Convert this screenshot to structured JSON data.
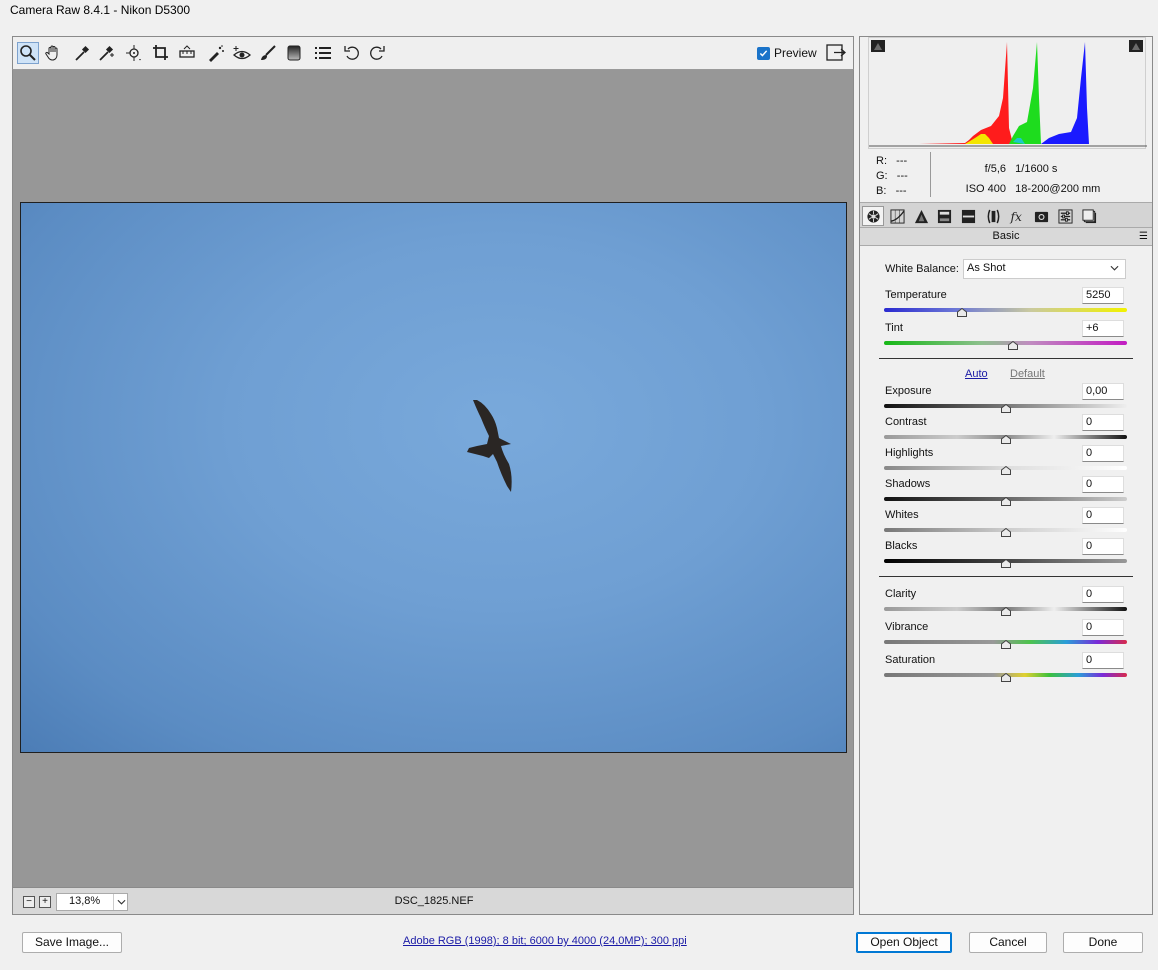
{
  "window": {
    "title": "Camera Raw 8.4.1  -  Nikon D5300"
  },
  "toolbar": {
    "tools": [
      {
        "name": "zoom-tool-icon",
        "active": true
      },
      {
        "name": "hand-tool-icon"
      },
      {
        "name": "white-balance-tool-icon"
      },
      {
        "name": "color-sampler-tool-icon"
      },
      {
        "name": "targeted-adjustment-tool-icon"
      },
      {
        "name": "crop-tool-icon"
      },
      {
        "name": "straighten-tool-icon"
      },
      {
        "name": "spot-removal-tool-icon"
      },
      {
        "name": "red-eye-removal-tool-icon"
      },
      {
        "name": "adjustment-brush-icon"
      },
      {
        "name": "graduated-filter-icon"
      },
      {
        "name": "preferences-list-icon"
      },
      {
        "name": "rotate-ccw-icon"
      },
      {
        "name": "rotate-cw-icon"
      }
    ],
    "preview_label": "Preview",
    "preview_checked": true
  },
  "status": {
    "zoom": "13,8%",
    "filename": "DSC_1825.NEF"
  },
  "info": {
    "r_label": "R:",
    "r_value": "---",
    "g_label": "G:",
    "g_value": "---",
    "b_label": "B:",
    "b_value": "---",
    "aperture": "f/5,6",
    "shutter": "1/1600 s",
    "iso": "ISO 400",
    "lens": "18-200@200 mm"
  },
  "panel": {
    "title": "Basic",
    "white_balance_label": "White Balance:",
    "white_balance_value": "As Shot",
    "auto_label": "Auto",
    "default_label": "Default",
    "sliders": [
      {
        "key": "temperature",
        "label": "Temperature",
        "value": "5250",
        "pos": 0.32
      },
      {
        "key": "tint",
        "label": "Tint",
        "value": "+6",
        "pos": 0.53
      },
      {
        "key": "exposure",
        "label": "Exposure",
        "value": "0,00",
        "pos": 0.5
      },
      {
        "key": "contrast",
        "label": "Contrast",
        "value": "0",
        "pos": 0.5
      },
      {
        "key": "highlights",
        "label": "Highlights",
        "value": "0",
        "pos": 0.5
      },
      {
        "key": "shadows",
        "label": "Shadows",
        "value": "0",
        "pos": 0.5
      },
      {
        "key": "whites",
        "label": "Whites",
        "value": "0",
        "pos": 0.5
      },
      {
        "key": "blacks",
        "label": "Blacks",
        "value": "0",
        "pos": 0.5
      },
      {
        "key": "clarity",
        "label": "Clarity",
        "value": "0",
        "pos": 0.5
      },
      {
        "key": "vibrance",
        "label": "Vibrance",
        "value": "0",
        "pos": 0.5
      },
      {
        "key": "saturation",
        "label": "Saturation",
        "value": "0",
        "pos": 0.5
      }
    ]
  },
  "footer": {
    "save_label": "Save Image...",
    "workflow_link": "Adobe RGB (1998); 8 bit; 6000 by 4000 (24,0MP); 300 ppi",
    "open_label": "Open Object",
    "cancel_label": "Cancel",
    "done_label": "Done"
  },
  "colors": {
    "accent": "#0078d4",
    "photo_sky": "#6f9fd3",
    "canvas": "#979797"
  }
}
